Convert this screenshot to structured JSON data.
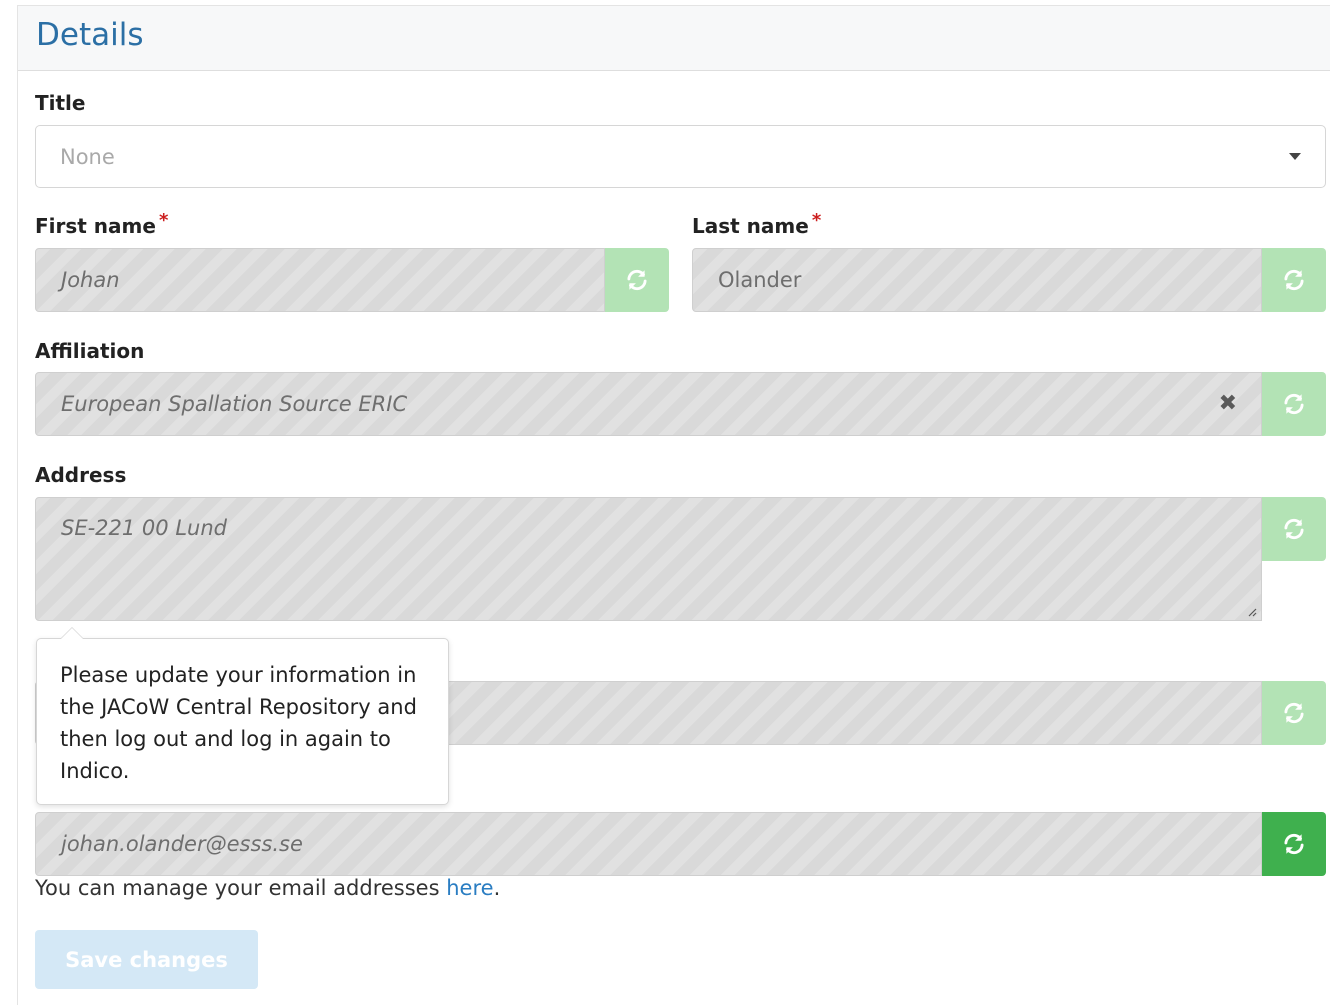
{
  "panel": {
    "title": "Details"
  },
  "title_field": {
    "label": "Title",
    "value": "None"
  },
  "first_name": {
    "label": "First name",
    "required_mark": "*",
    "value": "Johan"
  },
  "last_name": {
    "label": "Last name",
    "required_mark": "*",
    "value": "Olander"
  },
  "affiliation": {
    "label": "Affiliation",
    "value": "European Spallation Source ERIC",
    "clear_icon": "✖"
  },
  "address": {
    "label": "Address",
    "value": "SE-221 00 Lund"
  },
  "tooltip": {
    "text": "Please update your information in the JACoW Central Repository and then log out and log in again to Indico."
  },
  "email": {
    "value": "johan.olander@esss.se",
    "help_prefix": "You can manage your email addresses ",
    "help_link": "here",
    "help_suffix": "."
  },
  "actions": {
    "save_label": "Save changes"
  },
  "colors": {
    "accent": "#2b6fa5",
    "sync_light": "#b3e3b5",
    "sync_active": "#3fb04e",
    "required": "#cc1f1f",
    "link": "#2a7dc2",
    "save_disabled": "#d4e8f6"
  },
  "icons": {
    "sync": "sync-icon",
    "caret": "chevron-down-icon",
    "clear": "close-icon"
  }
}
